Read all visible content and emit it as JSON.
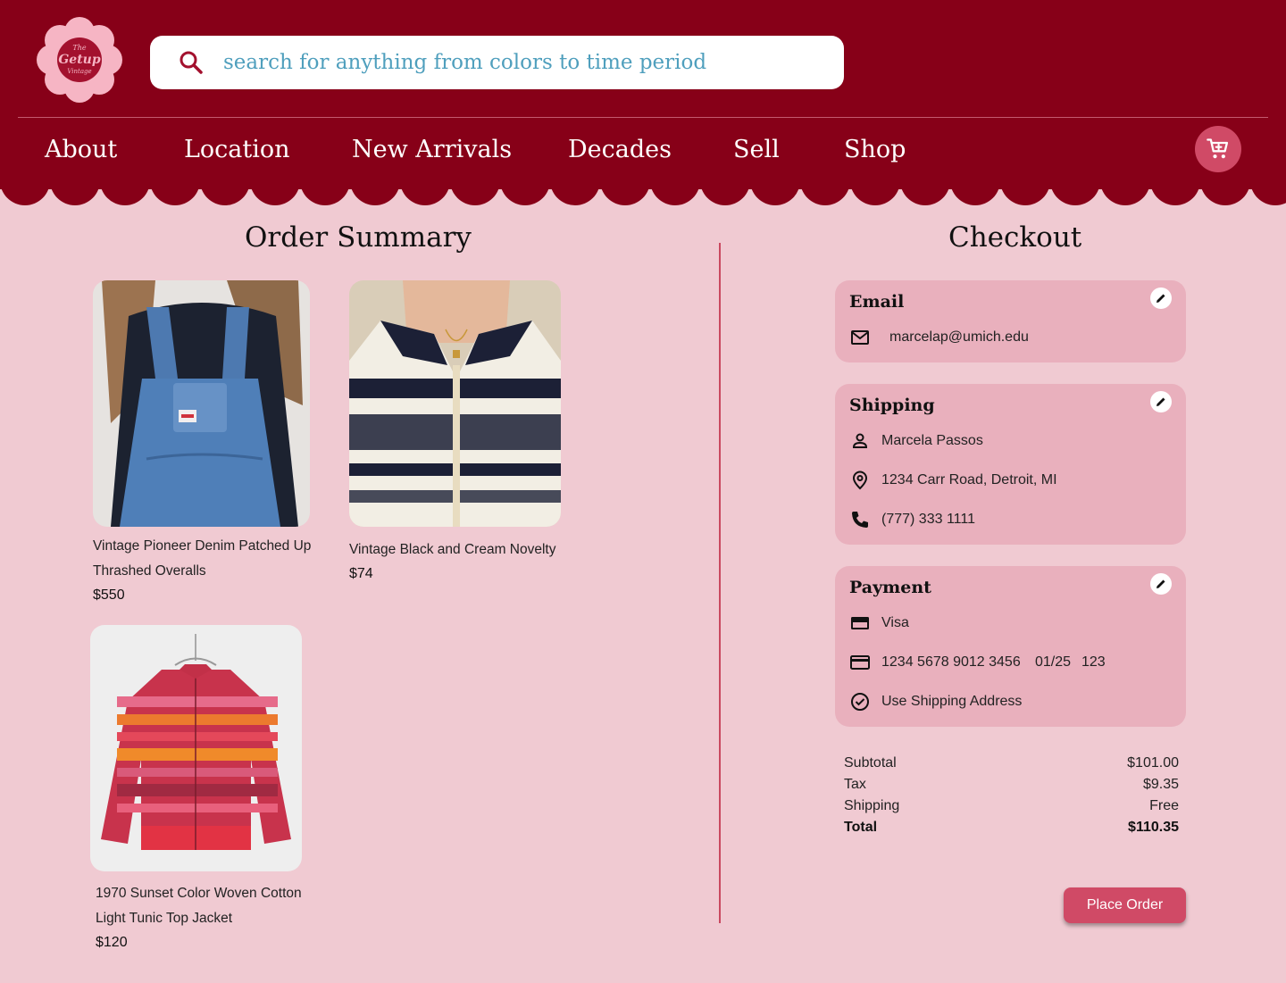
{
  "brand": {
    "logo_text_top": "The",
    "logo_text_main": "Getup",
    "logo_text_sub": "Vintage"
  },
  "search": {
    "placeholder": "search for anything from colors to time period",
    "icon": "search-icon"
  },
  "nav": {
    "items": [
      "About",
      "Location",
      "New Arrivals",
      "Decades",
      "Sell",
      "Shop"
    ],
    "cart_icon": "shopping-cart-icon"
  },
  "order_summary": {
    "title": "Order Summary",
    "products": [
      {
        "name": "Vintage Pioneer Denim Patched Up Thrashed Overalls",
        "price": "$550"
      },
      {
        "name": "Vintage Black and Cream Novelty",
        "price": "$74"
      },
      {
        "name": "1970 Sunset Color Woven Cotton Light Tunic Top Jacket",
        "price": "$120"
      }
    ]
  },
  "checkout": {
    "title": "Checkout",
    "email": {
      "title": "Email",
      "value": "marcelap@umich.edu",
      "icon": "mail-icon"
    },
    "shipping": {
      "title": "Shipping",
      "name": "Marcela Passos",
      "address": "1234  Carr Road, Detroit, MI",
      "phone": "(777) 333 1111"
    },
    "payment": {
      "title": "Payment",
      "card_type": "Visa",
      "card_number": "1234  5678 9012 3456",
      "expiry": "01/25",
      "cvv": "123",
      "billing": "Use Shipping Address"
    },
    "summary": {
      "subtotal_label": "Subtotal",
      "subtotal": "$101.00",
      "tax_label": "Tax",
      "tax": "$9.35",
      "shipping_label": "Shipping",
      "shipping": "Free",
      "total_label": "Total",
      "total": "$110.35"
    },
    "place_order": "Place Order"
  },
  "colors": {
    "header": "#870018",
    "page_bg": "#f0cad2",
    "card_bg": "#e9b0bd",
    "accent": "#d04a66",
    "search_text": "#4f9fbd"
  }
}
